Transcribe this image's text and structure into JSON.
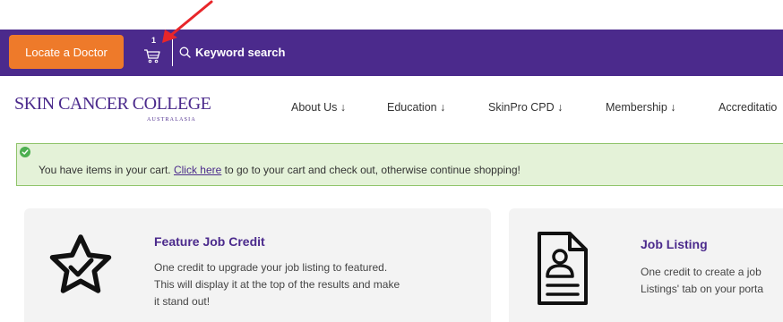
{
  "utility_bar": {
    "locate_label": "Locate a Doctor",
    "cart_count": "1",
    "search_label": "Keyword search",
    "bar_color": "#4b2a8c",
    "button_color": "#ee7a2a"
  },
  "logo": {
    "main": "SKIN CANCER COLLEGE",
    "sub": "AUSTRALASIA"
  },
  "nav": {
    "items": [
      {
        "label": "About Us ↓"
      },
      {
        "label": "Education ↓"
      },
      {
        "label": "SkinPro CPD ↓"
      },
      {
        "label": "Membership ↓"
      },
      {
        "label": "Accreditatio"
      }
    ]
  },
  "alert": {
    "text_before": "You have items in your cart. ",
    "link": "Click here",
    "text_after": " to go to your cart and check out, otherwise continue shopping!",
    "color": "#e4f2d8"
  },
  "cards": [
    {
      "title": "Feature Job Credit",
      "lines": [
        "One credit to upgrade your job listing to featured.",
        "This will display it at the top of the results and make",
        "it stand out!"
      ],
      "icon": "star-check-icon"
    },
    {
      "title": "Job Listing",
      "lines": [
        "One credit to create a job",
        "Listings' tab on your porta"
      ],
      "icon": "document-user-icon"
    }
  ]
}
